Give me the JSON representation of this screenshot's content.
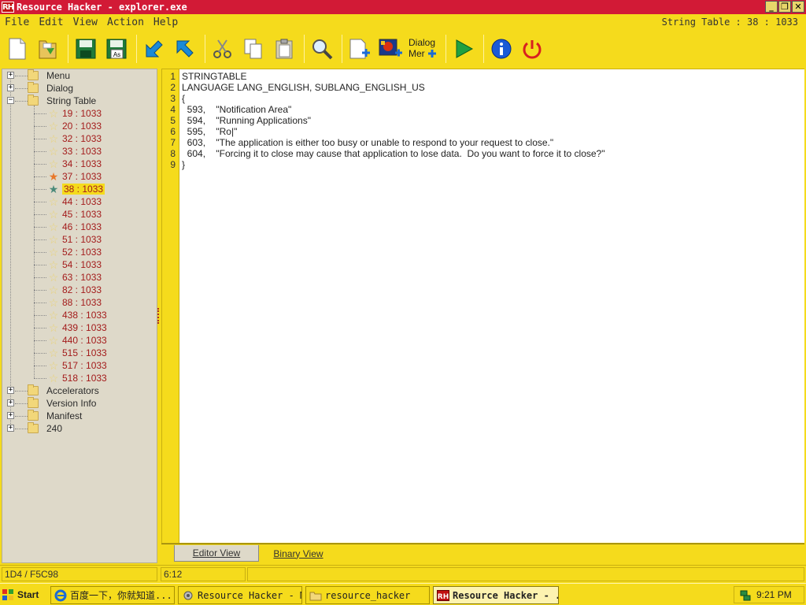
{
  "window": {
    "logo_text": "RH",
    "title": "Resource Hacker - explorer.exe",
    "buttons": [
      "minimize",
      "restore",
      "close"
    ]
  },
  "menu": {
    "items": [
      "File",
      "Edit",
      "View",
      "Action",
      "Help"
    ],
    "right_status": "String Table : 38 : 1033"
  },
  "toolbar": {
    "buttons": [
      {
        "name": "new",
        "icon": "new-file-icon"
      },
      {
        "name": "open",
        "icon": "open-folder-icon"
      },
      {
        "name": "save",
        "icon": "save-icon"
      },
      {
        "name": "save-as",
        "icon": "save-as-icon",
        "text": "As"
      },
      {
        "name": "back",
        "icon": "arrow-back-icon"
      },
      {
        "name": "forward",
        "icon": "arrow-forward-icon"
      },
      {
        "name": "cut",
        "icon": "scissors-icon"
      },
      {
        "name": "copy",
        "icon": "copy-icon"
      },
      {
        "name": "paste",
        "icon": "paste-icon"
      },
      {
        "name": "find",
        "icon": "magnifier-icon"
      },
      {
        "name": "add-resource",
        "icon": "add-resource-icon"
      },
      {
        "name": "add-image",
        "icon": "add-image-icon"
      },
      {
        "name": "dialog-merge",
        "icon": "dialog-merge-icon",
        "text": "Dialog Mer"
      },
      {
        "name": "compile",
        "icon": "play-icon"
      },
      {
        "name": "about",
        "icon": "info-icon"
      },
      {
        "name": "exit",
        "icon": "power-icon"
      }
    ]
  },
  "tree": {
    "top_level": [
      "Menu",
      "Dialog",
      "String Table"
    ],
    "string_table_items": [
      "19 : 1033",
      "20 : 1033",
      "32 : 1033",
      "33 : 1033",
      "34 : 1033",
      "37 : 1033",
      "38 : 1033",
      "44 : 1033",
      "45 : 1033",
      "46 : 1033",
      "51 : 1033",
      "52 : 1033",
      "54 : 1033",
      "63 : 1033",
      "82 : 1033",
      "88 : 1033",
      "438 : 1033",
      "439 : 1033",
      "440 : 1033",
      "515 : 1033",
      "517 : 1033",
      "518 : 1033"
    ],
    "selected_item": "38 : 1033",
    "bottom_level": [
      "Accelerators",
      "Version Info",
      "Manifest",
      "240"
    ]
  },
  "editor": {
    "line_numbers": [
      "1",
      "2",
      "3",
      "4",
      "5",
      "6",
      "7",
      "8",
      "9"
    ],
    "lines": [
      "STRINGTABLE",
      "LANGUAGE LANG_ENGLISH, SUBLANG_ENGLISH_US",
      "{",
      "  593,    \"Notification Area\"",
      "  594,    \"Running Applications\"",
      "  595,    \"Ro|\"",
      "  603,    \"The application is either too busy or unable to respond to your request to close.\"",
      "  604,    \"Forcing it to close may cause that application to lose data.  Do you want to force it to close?\"",
      "}"
    ]
  },
  "tabs": {
    "editor_view": "Editor View",
    "binary_view": "Binary View"
  },
  "status": {
    "offset": "1D4 / F5C98",
    "cursor": "6:12"
  },
  "taskbar": {
    "start": "Start",
    "tasks": [
      "百度一下，你就知道...",
      "Resource Hacker - My...",
      "resource_hacker",
      "Resource Hacker - ..."
    ],
    "clock": "9:21 PM"
  },
  "colors": {
    "accent": "#f5db1c",
    "titlebar": "#d21a36",
    "tree_bg": "#ded9c9"
  }
}
